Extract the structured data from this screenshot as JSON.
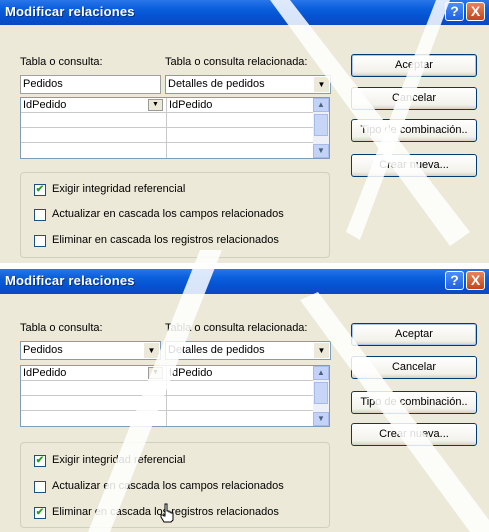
{
  "dialogs": [
    {
      "title": "Modificar relaciones",
      "help_btn": "?",
      "close_btn": "X",
      "table_label": "Tabla o consulta:",
      "related_label": "Tabla o consulta relacionada:",
      "table_value": "Pedidos",
      "related_value": "Detalles de pedidos",
      "grid": {
        "field1": "IdPedido",
        "field2": "IdPedido"
      },
      "checkboxes": [
        {
          "label": "Exigir integridad referencial",
          "checked": true,
          "mark": "✔"
        },
        {
          "label": "Actualizar en cascada los campos relacionados",
          "checked": false,
          "mark": ""
        },
        {
          "label": "Eliminar en cascada los registros relacionados",
          "checked": false,
          "mark": ""
        }
      ],
      "buttons": [
        "Aceptar",
        "Cancelar",
        "Tipo de combinación..",
        "Crear nueva..."
      ]
    },
    {
      "title": "Modificar relaciones",
      "help_btn": "?",
      "close_btn": "X",
      "table_label": "Tabla o consulta:",
      "related_label": "Tabla o consulta relacionada:",
      "table_value": "Pedidos",
      "related_value": "Detalles de pedidos",
      "grid": {
        "field1": "IdPedido",
        "field2": "IdPedido"
      },
      "checkboxes": [
        {
          "label": "Exigir integridad referencial",
          "checked": true,
          "mark": "✔"
        },
        {
          "label": "Actualizar en cascada los campos relacionados",
          "checked": false,
          "mark": ""
        },
        {
          "label": "Eliminar en cascada los registros relacionados",
          "checked": true,
          "mark": "✔"
        }
      ],
      "buttons": [
        "Aceptar",
        "Cancelar",
        "Tipo de combinación..",
        "Crear nueva..."
      ]
    }
  ],
  "colors": {
    "title_bar": "#0553d2",
    "dialog_bg": "#ece9d8",
    "watermark": "#000000"
  }
}
